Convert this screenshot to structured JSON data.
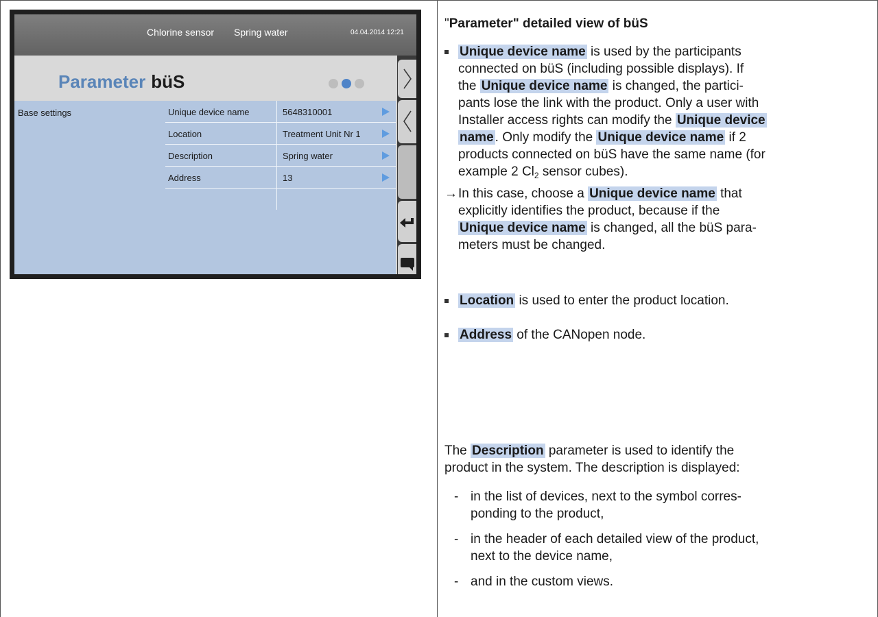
{
  "screen": {
    "top_bar": {
      "device_name": "Chlorine sensor",
      "description": "Spring water",
      "datetime": "04.04.2014 12:21"
    },
    "title": {
      "main": "Parameter",
      "suffix": "büS"
    },
    "pagination": {
      "pages": 3,
      "active": 2
    },
    "section_label": "Base settings",
    "parameters": [
      {
        "name": "Unique device name",
        "value": "5648310001"
      },
      {
        "name": "Location",
        "value": "Treatment Unit Nr 1"
      },
      {
        "name": "Description",
        "value": "Spring water"
      },
      {
        "name": "Address",
        "value": "13"
      }
    ],
    "nav_icons": [
      "chevron-right-icon",
      "chevron-left-icon",
      "scrollbar",
      "back-arrow-icon",
      "message-icon"
    ],
    "colors": {
      "accent": "#5a85b8",
      "active_dot": "#4f84c8",
      "content_bg": "#b3c6e0",
      "highlight": "#c4d4ec"
    }
  },
  "doc": {
    "title_quote_open": "\"",
    "title_term": "Parameter",
    "title_rest": "\" detailed view of büS",
    "bullet1": {
      "term": "Unique device name",
      "l1_rest": " is used by the participants",
      "l2": "connected on büS (including possible displays). If",
      "l3_pre": "the ",
      "l3_term": "Unique device name",
      "l3_rest": " is changed, the partici-",
      "l4": "pants lose the link with the product. Only a user with",
      "l5_pre": "Installer access rights can modify the ",
      "l5_term": "Unique device",
      "l6_term": "name",
      "l6_mid": ". Only modify the ",
      "l6_term2": "Unique device name",
      "l6_rest": " if 2",
      "l7": "products connected on büS have the same name (for",
      "l8_pre": "example 2 Cl",
      "l8_sub": "2",
      "l8_rest": "  sensor cubes)."
    },
    "arrow_block": {
      "arrow": "→",
      "l1_pre": "In this case, choose a ",
      "l1_term": "Unique device name",
      "l1_rest": " that",
      "l2": "explicitly identifies the product, because if the",
      "l3_term": "Unique device name",
      "l3_rest": " is changed, all the büS para-",
      "l4": "meters must be changed."
    },
    "bullet2": {
      "term": "Location",
      "rest": " is used to enter the product location."
    },
    "bullet3": {
      "term": "Address",
      "rest": " of the CANopen node."
    },
    "desc_para": {
      "l1_pre": "The ",
      "l1_term": "Description",
      "l1_rest": " parameter is used to identify the",
      "l2": "product in the system. The description is displayed:"
    },
    "dash_items": [
      {
        "l1": "in the list of devices, next to the symbol corres-",
        "l2": "ponding to the product,"
      },
      {
        "l1": "in the header of each detailed view of the product,",
        "l2": "next to the device name,"
      },
      {
        "l1": "and in the custom views.",
        "l2": ""
      }
    ],
    "dash": "-"
  }
}
